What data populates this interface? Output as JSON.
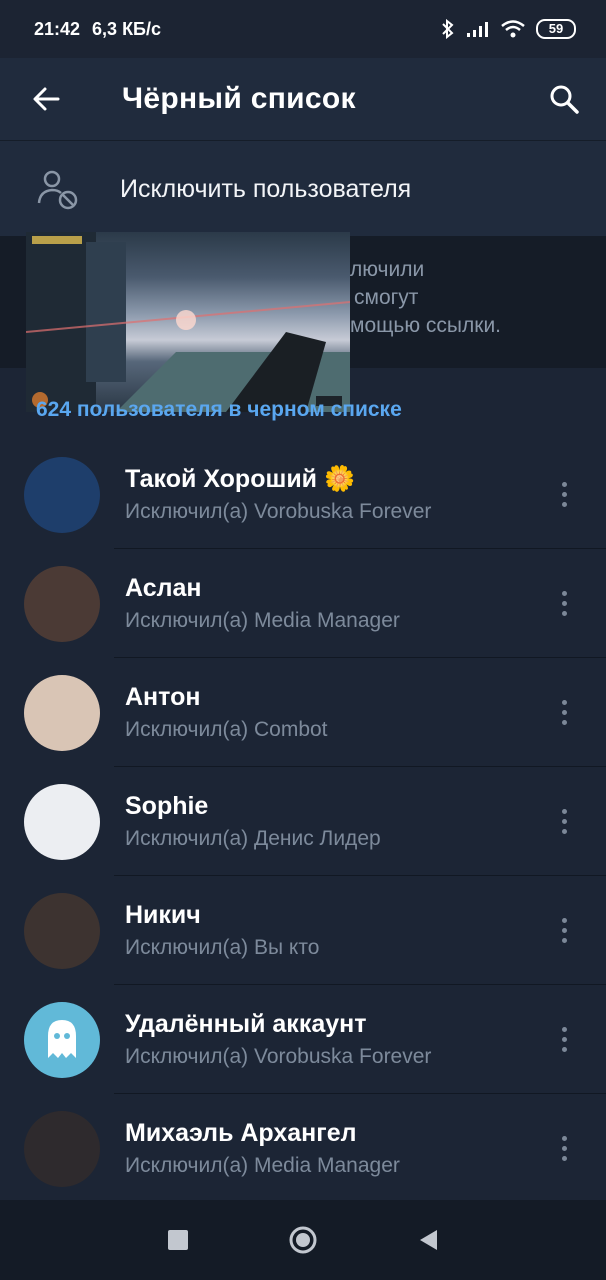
{
  "status_bar": {
    "time": "21:42",
    "speed": "6,3 КБ/с",
    "battery": "59"
  },
  "toolbar": {
    "title": "Чёрный список"
  },
  "exclude_action": {
    "label": "Исключить пользователя"
  },
  "info": {
    "lines": [
      "лючили",
      "смогут",
      "мощью ссылки."
    ]
  },
  "section": {
    "header": "624 пользователя в черном списке"
  },
  "users": [
    {
      "name": "Такой Хороший 🌼",
      "by": "Исключил(а) Vorobuska Forever",
      "avatar_color": "#1e3e6b"
    },
    {
      "name": "Аслан",
      "by": "Исключил(а) Media Manager",
      "avatar_color": "#4b3a35"
    },
    {
      "name": "Антон",
      "by": "Исключил(а) Combot",
      "avatar_color": "#d9c5b5"
    },
    {
      "name": "Sophie",
      "by": "Исключил(а) Денис Лидер",
      "avatar_color": "#eceef2"
    },
    {
      "name": "Никич",
      "by": "Исключил(а) Вы кто",
      "avatar_color": "#3d3330"
    },
    {
      "name": "Удалённый аккаунт",
      "by": "Исключил(а) Vorobuska Forever",
      "avatar_color": "#61b9d8"
    },
    {
      "name": "Михаэль Архангел",
      "by": "Исключил(а) Media Manager",
      "avatar_color": "#2e2a2d"
    }
  ]
}
